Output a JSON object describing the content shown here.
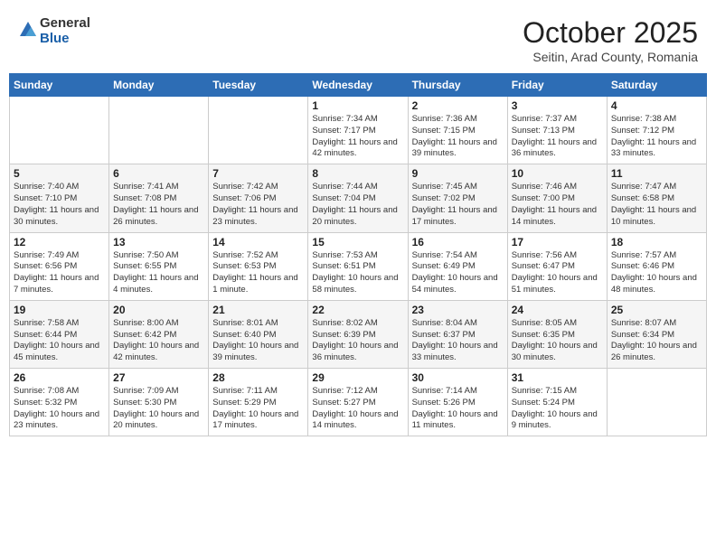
{
  "header": {
    "logo_general": "General",
    "logo_blue": "Blue",
    "month_title": "October 2025",
    "location": "Seitin, Arad County, Romania"
  },
  "days_of_week": [
    "Sunday",
    "Monday",
    "Tuesday",
    "Wednesday",
    "Thursday",
    "Friday",
    "Saturday"
  ],
  "weeks": [
    [
      null,
      null,
      null,
      {
        "day": 1,
        "sunrise": "7:34 AM",
        "sunset": "7:17 PM",
        "daylight": "11 hours and 42 minutes."
      },
      {
        "day": 2,
        "sunrise": "7:36 AM",
        "sunset": "7:15 PM",
        "daylight": "11 hours and 39 minutes."
      },
      {
        "day": 3,
        "sunrise": "7:37 AM",
        "sunset": "7:13 PM",
        "daylight": "11 hours and 36 minutes."
      },
      {
        "day": 4,
        "sunrise": "7:38 AM",
        "sunset": "7:12 PM",
        "daylight": "11 hours and 33 minutes."
      }
    ],
    [
      {
        "day": 5,
        "sunrise": "7:40 AM",
        "sunset": "7:10 PM",
        "daylight": "11 hours and 30 minutes."
      },
      {
        "day": 6,
        "sunrise": "7:41 AM",
        "sunset": "7:08 PM",
        "daylight": "11 hours and 26 minutes."
      },
      {
        "day": 7,
        "sunrise": "7:42 AM",
        "sunset": "7:06 PM",
        "daylight": "11 hours and 23 minutes."
      },
      {
        "day": 8,
        "sunrise": "7:44 AM",
        "sunset": "7:04 PM",
        "daylight": "11 hours and 20 minutes."
      },
      {
        "day": 9,
        "sunrise": "7:45 AM",
        "sunset": "7:02 PM",
        "daylight": "11 hours and 17 minutes."
      },
      {
        "day": 10,
        "sunrise": "7:46 AM",
        "sunset": "7:00 PM",
        "daylight": "11 hours and 14 minutes."
      },
      {
        "day": 11,
        "sunrise": "7:47 AM",
        "sunset": "6:58 PM",
        "daylight": "11 hours and 10 minutes."
      }
    ],
    [
      {
        "day": 12,
        "sunrise": "7:49 AM",
        "sunset": "6:56 PM",
        "daylight": "11 hours and 7 minutes."
      },
      {
        "day": 13,
        "sunrise": "7:50 AM",
        "sunset": "6:55 PM",
        "daylight": "11 hours and 4 minutes."
      },
      {
        "day": 14,
        "sunrise": "7:52 AM",
        "sunset": "6:53 PM",
        "daylight": "11 hours and 1 minute."
      },
      {
        "day": 15,
        "sunrise": "7:53 AM",
        "sunset": "6:51 PM",
        "daylight": "10 hours and 58 minutes."
      },
      {
        "day": 16,
        "sunrise": "7:54 AM",
        "sunset": "6:49 PM",
        "daylight": "10 hours and 54 minutes."
      },
      {
        "day": 17,
        "sunrise": "7:56 AM",
        "sunset": "6:47 PM",
        "daylight": "10 hours and 51 minutes."
      },
      {
        "day": 18,
        "sunrise": "7:57 AM",
        "sunset": "6:46 PM",
        "daylight": "10 hours and 48 minutes."
      }
    ],
    [
      {
        "day": 19,
        "sunrise": "7:58 AM",
        "sunset": "6:44 PM",
        "daylight": "10 hours and 45 minutes."
      },
      {
        "day": 20,
        "sunrise": "8:00 AM",
        "sunset": "6:42 PM",
        "daylight": "10 hours and 42 minutes."
      },
      {
        "day": 21,
        "sunrise": "8:01 AM",
        "sunset": "6:40 PM",
        "daylight": "10 hours and 39 minutes."
      },
      {
        "day": 22,
        "sunrise": "8:02 AM",
        "sunset": "6:39 PM",
        "daylight": "10 hours and 36 minutes."
      },
      {
        "day": 23,
        "sunrise": "8:04 AM",
        "sunset": "6:37 PM",
        "daylight": "10 hours and 33 minutes."
      },
      {
        "day": 24,
        "sunrise": "8:05 AM",
        "sunset": "6:35 PM",
        "daylight": "10 hours and 30 minutes."
      },
      {
        "day": 25,
        "sunrise": "8:07 AM",
        "sunset": "6:34 PM",
        "daylight": "10 hours and 26 minutes."
      }
    ],
    [
      {
        "day": 26,
        "sunrise": "7:08 AM",
        "sunset": "5:32 PM",
        "daylight": "10 hours and 23 minutes."
      },
      {
        "day": 27,
        "sunrise": "7:09 AM",
        "sunset": "5:30 PM",
        "daylight": "10 hours and 20 minutes."
      },
      {
        "day": 28,
        "sunrise": "7:11 AM",
        "sunset": "5:29 PM",
        "daylight": "10 hours and 17 minutes."
      },
      {
        "day": 29,
        "sunrise": "7:12 AM",
        "sunset": "5:27 PM",
        "daylight": "10 hours and 14 minutes."
      },
      {
        "day": 30,
        "sunrise": "7:14 AM",
        "sunset": "5:26 PM",
        "daylight": "10 hours and 11 minutes."
      },
      {
        "day": 31,
        "sunrise": "7:15 AM",
        "sunset": "5:24 PM",
        "daylight": "10 hours and 9 minutes."
      },
      null
    ]
  ]
}
